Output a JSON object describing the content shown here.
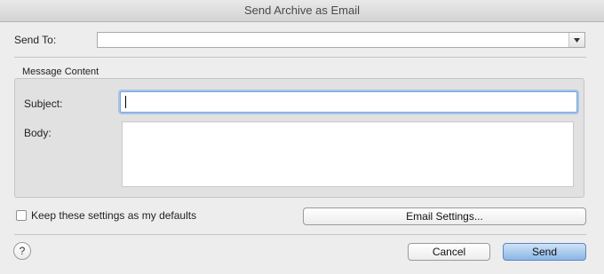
{
  "window": {
    "title": "Send Archive as Email"
  },
  "send_to": {
    "label": "Send To:",
    "value": "",
    "dropdown_icon": "chevron-down-icon"
  },
  "message_content": {
    "group_label": "Message Content",
    "subject_label": "Subject:",
    "subject_value": "",
    "body_label": "Body:",
    "body_value": ""
  },
  "defaults_checkbox": {
    "label": "Keep these settings as my defaults",
    "checked": false
  },
  "buttons": {
    "email_settings": "Email Settings...",
    "cancel": "Cancel",
    "send": "Send",
    "help": "?"
  },
  "colors": {
    "focus_ring": "#a5c4ea",
    "default_button": "#8ab6e6"
  }
}
